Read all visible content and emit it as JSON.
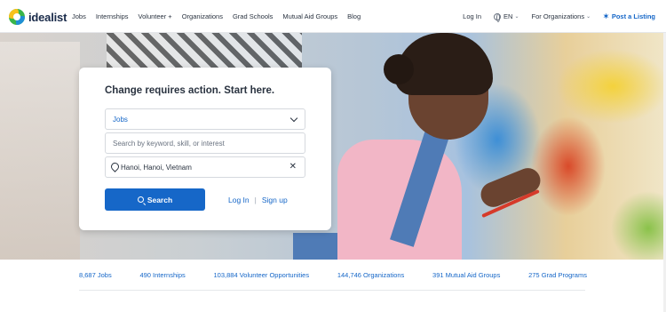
{
  "brand": {
    "name": "idealist"
  },
  "nav": {
    "links": [
      "Jobs",
      "Internships",
      "Volunteer +",
      "Organizations",
      "Grad Schools",
      "Mutual Aid Groups",
      "Blog"
    ],
    "login": "Log In",
    "language": "EN",
    "for_orgs": "For Organizations",
    "post_listing": "Post a Listing"
  },
  "search": {
    "title": "Change requires action. Start here.",
    "category": "Jobs",
    "keyword_placeholder": "Search by keyword, skill, or interest",
    "location": "Hanoi, Hanoi, Vietnam",
    "button": "Search",
    "login": "Log In",
    "separator": "|",
    "signup": "Sign up"
  },
  "stats": [
    "8,687 Jobs",
    "490 Internships",
    "103,884 Volunteer Opportunities",
    "144,746 Organizations",
    "391 Mutual Aid Groups",
    "275 Grad Programs"
  ],
  "colors": {
    "accent": "#1667c8",
    "text": "#2a3340"
  }
}
